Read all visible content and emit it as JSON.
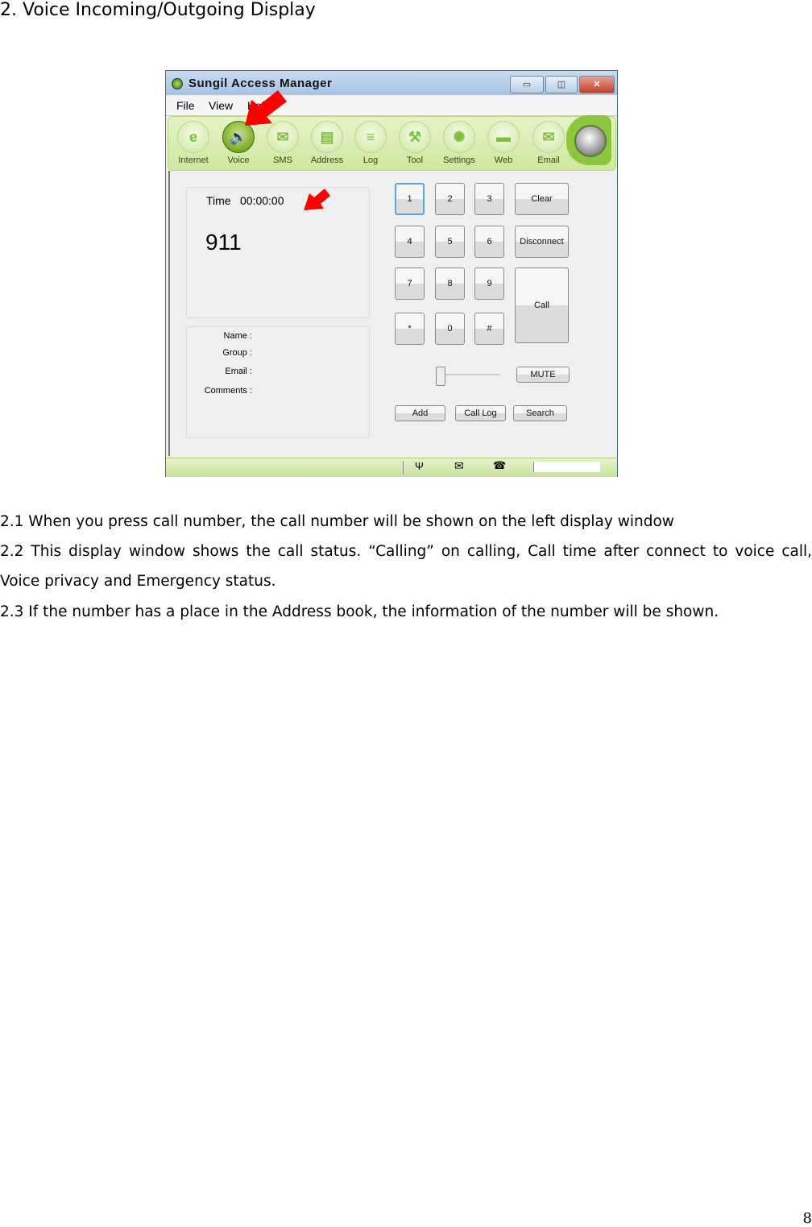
{
  "heading": "2. Voice Incoming/Outgoing Display",
  "app": {
    "title": "Sungil Access Manager",
    "window_buttons": {
      "minimize": "▭",
      "maximize": "◫",
      "close": "✕"
    },
    "menu": [
      "File",
      "View",
      "Help"
    ],
    "toolbar": [
      {
        "label": "Internet",
        "icon": "internet-icon",
        "glyph": "e"
      },
      {
        "label": "Voice",
        "icon": "speaker-icon",
        "glyph": "🔊",
        "active": true
      },
      {
        "label": "SMS",
        "icon": "envelope-icon",
        "glyph": "✉"
      },
      {
        "label": "Address",
        "icon": "address-book-icon",
        "glyph": "▤"
      },
      {
        "label": "Log",
        "icon": "log-icon",
        "glyph": "≡"
      },
      {
        "label": "Tool",
        "icon": "tool-icon",
        "glyph": "⚒"
      },
      {
        "label": "Settings",
        "icon": "gear-icon",
        "glyph": "✺"
      },
      {
        "label": "Web",
        "icon": "web-icon",
        "glyph": "▬"
      },
      {
        "label": "Email",
        "icon": "email-icon",
        "glyph": "✉"
      }
    ],
    "display": {
      "time_label": "Time",
      "time": "00:00:00",
      "number": "911"
    },
    "info": {
      "name": "Name  :",
      "group": "Group :",
      "email": "Email :",
      "comments": "Comments :"
    },
    "keypad": [
      "1",
      "2",
      "3",
      "4",
      "5",
      "6",
      "7",
      "8",
      "9",
      "*",
      "0",
      "#"
    ],
    "actions": {
      "clear": "Clear",
      "disconnect": "Disconnect",
      "call": "Call",
      "mute": "MUTE",
      "add": "Add",
      "call_log": "Call Log",
      "search": "Search"
    },
    "volume_level": 0,
    "status_icons": {
      "signal": "Ψ",
      "message": "✉",
      "call": "☎"
    },
    "accent": "#8cc63f"
  },
  "paragraphs": [
    "2.1 When you press call number, the call number will be shown on the left display window",
    "2.2 This display window shows the call status.  “Calling” on calling, Call time after connect to voice call, Voice privacy and Emergency status.",
    "2.3 If the number has a place in the Address book, the information of the number will be shown."
  ],
  "page_number": "8"
}
